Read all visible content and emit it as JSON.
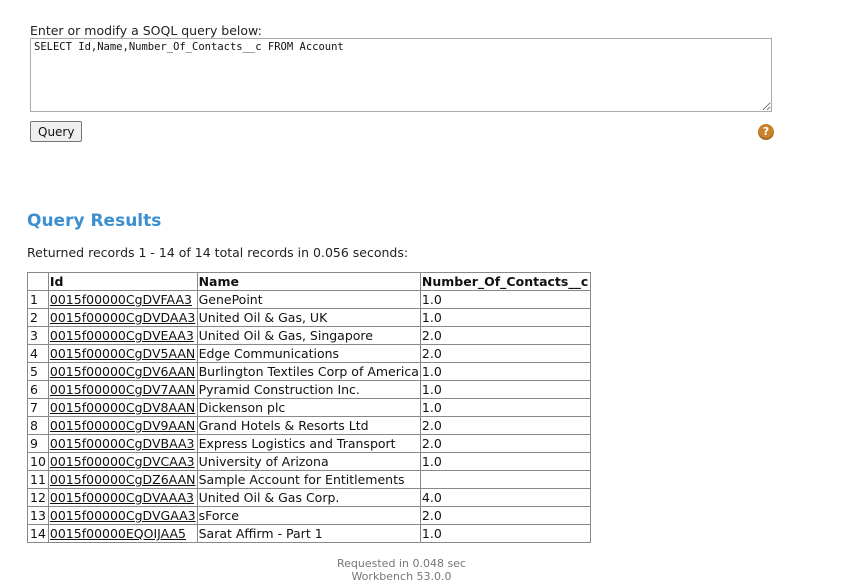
{
  "query_form": {
    "prompt": "Enter or modify a SOQL query below:",
    "query_text": "SELECT Id,Name,Number_Of_Contacts__c FROM Account",
    "query_button": "Query",
    "help_icon_glyph": "?"
  },
  "results": {
    "title": "Query Results",
    "summary": "Returned records 1 - 14 of 14 total records in 0.056 seconds:",
    "columns": [
      "",
      "Id",
      "Name",
      "Number_Of_Contacts__c"
    ],
    "rows": [
      {
        "n": "1",
        "id": "0015f00000CgDVFAA3",
        "name": "GenePoint",
        "contacts": "1.0"
      },
      {
        "n": "2",
        "id": "0015f00000CgDVDAA3",
        "name": "United Oil & Gas, UK",
        "contacts": "1.0"
      },
      {
        "n": "3",
        "id": "0015f00000CgDVEAA3",
        "name": "United Oil & Gas, Singapore",
        "contacts": "2.0"
      },
      {
        "n": "4",
        "id": "0015f00000CgDV5AAN",
        "name": "Edge Communications",
        "contacts": "2.0"
      },
      {
        "n": "5",
        "id": "0015f00000CgDV6AAN",
        "name": "Burlington Textiles Corp of America",
        "contacts": "1.0"
      },
      {
        "n": "6",
        "id": "0015f00000CgDV7AAN",
        "name": "Pyramid Construction Inc.",
        "contacts": "1.0"
      },
      {
        "n": "7",
        "id": "0015f00000CgDV8AAN",
        "name": "Dickenson plc",
        "contacts": "1.0"
      },
      {
        "n": "8",
        "id": "0015f00000CgDV9AAN",
        "name": "Grand Hotels & Resorts Ltd",
        "contacts": "2.0"
      },
      {
        "n": "9",
        "id": "0015f00000CgDVBAA3",
        "name": "Express Logistics and Transport",
        "contacts": "2.0"
      },
      {
        "n": "10",
        "id": "0015f00000CgDVCAA3",
        "name": "University of Arizona",
        "contacts": "1.0"
      },
      {
        "n": "11",
        "id": "0015f00000CgDZ6AAN",
        "name": "Sample Account for Entitlements",
        "contacts": ""
      },
      {
        "n": "12",
        "id": "0015f00000CgDVAAA3",
        "name": "United Oil & Gas Corp.",
        "contacts": "4.0"
      },
      {
        "n": "13",
        "id": "0015f00000CgDVGAA3",
        "name": "sForce",
        "contacts": "2.0"
      },
      {
        "n": "14",
        "id": "0015f00000EQOIJAA5",
        "name": "Sarat Affirm - Part 1",
        "contacts": "1.0"
      }
    ]
  },
  "footer": {
    "requested": "Requested in 0.048 sec",
    "version": "Workbench 53.0.0"
  },
  "colors": {
    "accent_title": "#3b8fd0",
    "help_icon": "#c9822b"
  }
}
